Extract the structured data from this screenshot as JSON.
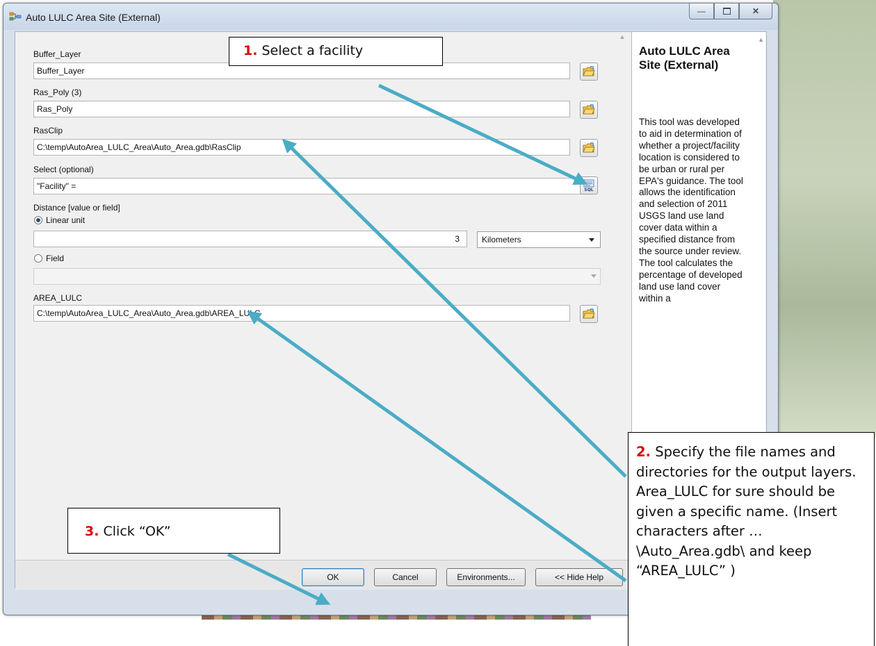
{
  "window": {
    "title": "Auto LULC Area Site (External)",
    "controls": [
      "minimize",
      "maximize",
      "close"
    ]
  },
  "form": {
    "buffer_layer": {
      "label": "Buffer_Layer",
      "value": "Buffer_Layer"
    },
    "ras_poly": {
      "label": "Ras_Poly (3)",
      "value": "Ras_Poly"
    },
    "ras_clip": {
      "label": "RasClip",
      "value": "C:\\temp\\AutoArea_LULC_Area\\Auto_Area.gdb\\RasClip"
    },
    "select": {
      "label": "Select (optional)",
      "value": "\"Facility\" =",
      "button_icon": "sql-query-icon"
    },
    "distance": {
      "label": "Distance [value or field]",
      "linear_unit_label": "Linear unit",
      "linear_unit_selected": true,
      "value": "3",
      "unit": "Kilometers",
      "field_label": "Field",
      "field_selected": false,
      "field_value": ""
    },
    "area_lulc": {
      "label": "AREA_LULC",
      "value": "C:\\temp\\AutoArea_LULC_Area\\Auto_Area.gdb\\AREA_LULC"
    }
  },
  "buttons": {
    "ok": "OK",
    "cancel": "Cancel",
    "environments": "Environments...",
    "hide_help": "<< Hide Help"
  },
  "help": {
    "title": "Auto LULC Area Site (External)",
    "body": "This tool was developed to aid in determination of whether a project/facility location is considered to be urban or rural per EPA's guidance. The tool allows the identification and selection of 2011 USGS land use land cover data within a specified distance from the source under review. The tool calculates the percentage of developed land use land cover within a"
  },
  "callouts": [
    {
      "number": "1.",
      "text": "Select a facility"
    },
    {
      "number": "2.",
      "text": "Specify the file names and directories for the output layers.  Area_LULC for sure should be given a specific name. (Insert characters after …\\Auto_Area.gdb\\ and keep “AREA_LULC” )"
    },
    {
      "number": "3.",
      "text": "Click “OK”"
    }
  ],
  "colors": {
    "callout_number": "#e00000",
    "arrow": "#4bacc6",
    "window_frame": "#d6dfea"
  }
}
